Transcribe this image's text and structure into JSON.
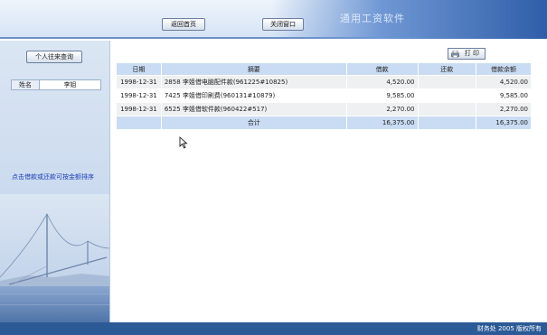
{
  "header": {
    "title": "通用工资软件",
    "home_button": "返回首页",
    "close_button": "关闭窗口"
  },
  "sidebar": {
    "query_button": "个人往来查询",
    "name_label": "姓名",
    "name_value": "李姐",
    "sort_tip": "点击借款或还款可按金额排序"
  },
  "toolbar": {
    "print_label": "打 印"
  },
  "table": {
    "headers": [
      "日期",
      "摘要",
      "借款",
      "还款",
      "借款余额"
    ],
    "rows": [
      {
        "date": "1998-12-31",
        "summary": "2858 李姐借电脑配件款(961225#10825)",
        "borrow": "4,520.00",
        "repay": "",
        "balance": "4,520.00"
      },
      {
        "date": "1998-12-31",
        "summary": "7425 李姐借印刷费(960131#10879)",
        "borrow": "9,585.00",
        "repay": "",
        "balance": "9,585.00"
      },
      {
        "date": "1998-12-31",
        "summary": "6525 李姐借软件款(960422#517)",
        "borrow": "2,270.00",
        "repay": "",
        "balance": "2,270.00"
      }
    ],
    "total": {
      "label": "合计",
      "borrow": "16,375.00",
      "repay": "",
      "balance": "16,375.00"
    }
  },
  "footer": {
    "copyright": "财务处 2005 版权所有"
  }
}
